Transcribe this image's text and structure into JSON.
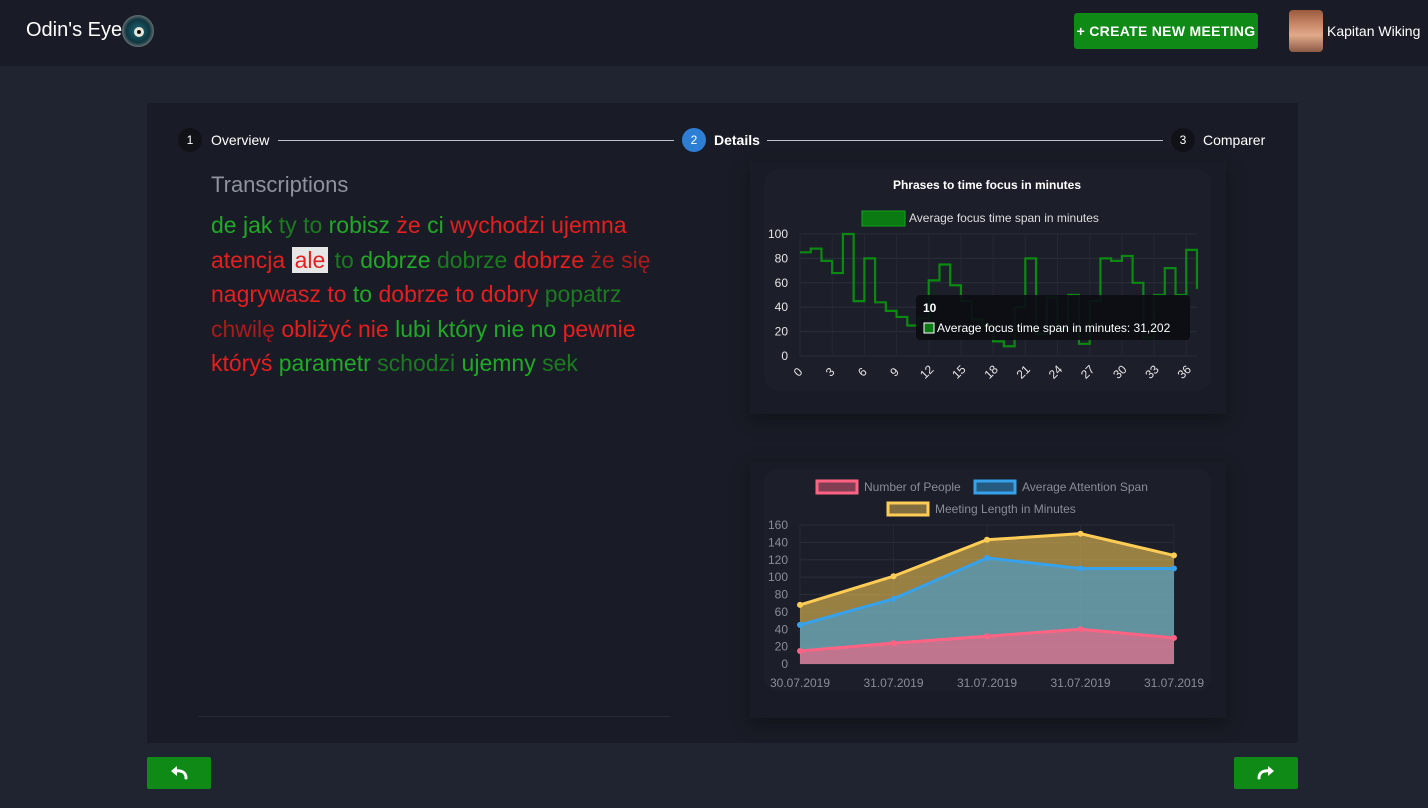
{
  "header": {
    "brand": "Odin's Eye",
    "create_button": "+ CREATE NEW MEETING",
    "username": "Kapitan Wiking"
  },
  "stepper": [
    {
      "number": "1",
      "label": "Overview",
      "active": false
    },
    {
      "number": "2",
      "label": "Details",
      "active": true
    },
    {
      "number": "3",
      "label": "Comparer",
      "active": false
    }
  ],
  "transcript": {
    "title": "Transcriptions",
    "words": [
      {
        "text": "de",
        "tone": "g"
      },
      {
        "text": "jak",
        "tone": "g"
      },
      {
        "text": "ty",
        "tone": "dg"
      },
      {
        "text": "to",
        "tone": "dg"
      },
      {
        "text": "robisz",
        "tone": "g"
      },
      {
        "text": "że",
        "tone": "r"
      },
      {
        "text": "ci",
        "tone": "g"
      },
      {
        "text": "wychodzi",
        "tone": "r"
      },
      {
        "text": "ujemna",
        "tone": "r"
      },
      {
        "text": "atencja",
        "tone": "r"
      },
      {
        "text": "ale",
        "tone": "hl"
      },
      {
        "text": "to",
        "tone": "dg"
      },
      {
        "text": "dobrze",
        "tone": "g"
      },
      {
        "text": "dobrze",
        "tone": "dg"
      },
      {
        "text": "dobrze",
        "tone": "r"
      },
      {
        "text": "że",
        "tone": "dr"
      },
      {
        "text": "się",
        "tone": "dr"
      },
      {
        "text": "nagrywasz",
        "tone": "r"
      },
      {
        "text": "to",
        "tone": "r"
      },
      {
        "text": "to",
        "tone": "g"
      },
      {
        "text": "dobrze",
        "tone": "r"
      },
      {
        "text": "to",
        "tone": "r"
      },
      {
        "text": "dobry",
        "tone": "r"
      },
      {
        "text": "popatrz",
        "tone": "dg"
      },
      {
        "text": "chwilę",
        "tone": "dr"
      },
      {
        "text": "oblizyc",
        "tone": "r",
        "display": "obliżyć"
      },
      {
        "text": "nie",
        "tone": "r"
      },
      {
        "text": "lubi",
        "tone": "g"
      },
      {
        "text": "który",
        "tone": "g"
      },
      {
        "text": "nie",
        "tone": "g"
      },
      {
        "text": "no",
        "tone": "g"
      },
      {
        "text": "pewnie",
        "tone": "r"
      },
      {
        "text": "któryś",
        "tone": "r"
      },
      {
        "text": "parametr",
        "tone": "g"
      },
      {
        "text": "schodzi",
        "tone": "dg"
      },
      {
        "text": "ujemny",
        "tone": "g"
      },
      {
        "text": "sek",
        "tone": "dg"
      }
    ]
  },
  "colors": {
    "green": "#21a827",
    "dark_green": "#1b7a1f",
    "red": "#e51f1f",
    "dark_red": "#a81b1b",
    "accent_blue": "#2d7fd6",
    "button_green": "#0f8a17"
  },
  "chart_data": [
    {
      "type": "line",
      "title": "Phrases to time focus in minutes",
      "stepped": true,
      "series": [
        {
          "name": "Average focus time span in minutes",
          "color": "#0b7a12",
          "x": [
            0,
            1,
            2,
            3,
            4,
            5,
            6,
            7,
            8,
            9,
            10,
            11,
            12,
            13,
            14,
            15,
            16,
            17,
            18,
            19,
            20,
            21,
            22,
            23,
            24,
            25,
            26,
            27,
            28,
            29,
            30,
            31,
            32,
            33,
            34,
            35,
            36,
            37
          ],
          "values": [
            85,
            88,
            78,
            68,
            100,
            45,
            80,
            44,
            37,
            32,
            25,
            31,
            62,
            75,
            58,
            45,
            30,
            25,
            12,
            8,
            40,
            80,
            18,
            48,
            22,
            50,
            10,
            45,
            80,
            78,
            82,
            60,
            15,
            50,
            72,
            50,
            87,
            55
          ]
        }
      ],
      "xticks": [
        "0",
        "3",
        "6",
        "9",
        "12",
        "15",
        "18",
        "21",
        "24",
        "27",
        "30",
        "33",
        "36"
      ],
      "yticks": [
        "0",
        "20",
        "40",
        "60",
        "80",
        "100"
      ],
      "ylim": [
        0,
        100
      ],
      "legend": "top",
      "tooltip": {
        "title": "10",
        "text": "Average focus time span in minutes: 31,202"
      }
    },
    {
      "type": "area",
      "categories": [
        "30.07.2019",
        "31.07.2019",
        "31.07.2019",
        "31.07.2019",
        "31.07.2019"
      ],
      "series": [
        {
          "name": "Number of People",
          "color": "#ff6384",
          "values": [
            15,
            24,
            32,
            40,
            30
          ]
        },
        {
          "name": "Average Attention Span",
          "color": "#36a2eb",
          "values": [
            45,
            75,
            122,
            110,
            110
          ]
        },
        {
          "name": "Meeting Length in Minutes",
          "color": "#ffcd56",
          "values": [
            68,
            101,
            143,
            150,
            125
          ]
        }
      ],
      "yticks": [
        "0",
        "20",
        "40",
        "60",
        "80",
        "100",
        "120",
        "140",
        "160"
      ],
      "ylim": [
        0,
        160
      ],
      "legend": "top"
    }
  ]
}
